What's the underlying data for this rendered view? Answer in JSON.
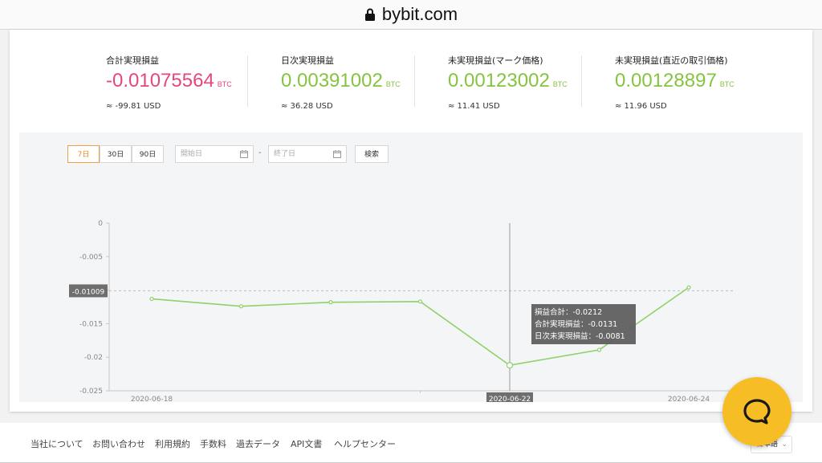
{
  "browser": {
    "url": "bybit.com"
  },
  "stats": [
    {
      "label": "合計実現損益",
      "value": "-0.01075564",
      "unit": "BTC",
      "usd": "≈ -99.81 USD",
      "color": "#e6477a"
    },
    {
      "label": "日次実現損益",
      "value": "0.00391002",
      "unit": "BTC",
      "usd": "≈ 36.28 USD",
      "color": "#86c440"
    },
    {
      "label": "未実現損益(マーク価格)",
      "value": "0.00123002",
      "unit": "BTC",
      "usd": "≈ 11.41 USD",
      "color": "#86c440"
    },
    {
      "label": "未実現損益(直近の取引価格)",
      "value": "0.00128897",
      "unit": "BTC",
      "usd": "≈ 11.96 USD",
      "color": "#86c440"
    }
  ],
  "filters": {
    "range_buttons": [
      "7日",
      "30日",
      "90日"
    ],
    "active_range": "7日",
    "start_placeholder": "開始日",
    "end_placeholder": "終了日",
    "separator": "-",
    "search_label": "検索"
  },
  "chart_data": {
    "type": "line",
    "y_ticks": [
      "0",
      "-0.005",
      "-0.01",
      "-0.015",
      "-0.02",
      "-0.025"
    ],
    "ylim": [
      -0.025,
      0
    ],
    "x_ticks": [
      "2020-06-18",
      "2020-06-22",
      "2020-06-24"
    ],
    "x": [
      "2020-06-18",
      "2020-06-19",
      "2020-06-20",
      "2020-06-21",
      "2020-06-22",
      "2020-06-23",
      "2020-06-24"
    ],
    "values": [
      -0.0113,
      -0.0124,
      -0.0118,
      -0.0117,
      -0.0212,
      -0.0189,
      -0.0096
    ],
    "line_color": "#8fd16a",
    "reference_value": -0.0101,
    "reference_label": "-0.01009",
    "hover_index": 4,
    "hover_x_label": "2020-06-22",
    "tooltip": [
      "損益合計：-0.0212",
      "合計実現損益：-0.0131",
      "日次未実現損益：-0.0081"
    ]
  },
  "footer": {
    "links": [
      "当社について",
      "お問い合わせ",
      "利用規約",
      "手数料",
      "過去データ",
      "API文書",
      "ヘルプセンター"
    ],
    "language": "日本語"
  }
}
